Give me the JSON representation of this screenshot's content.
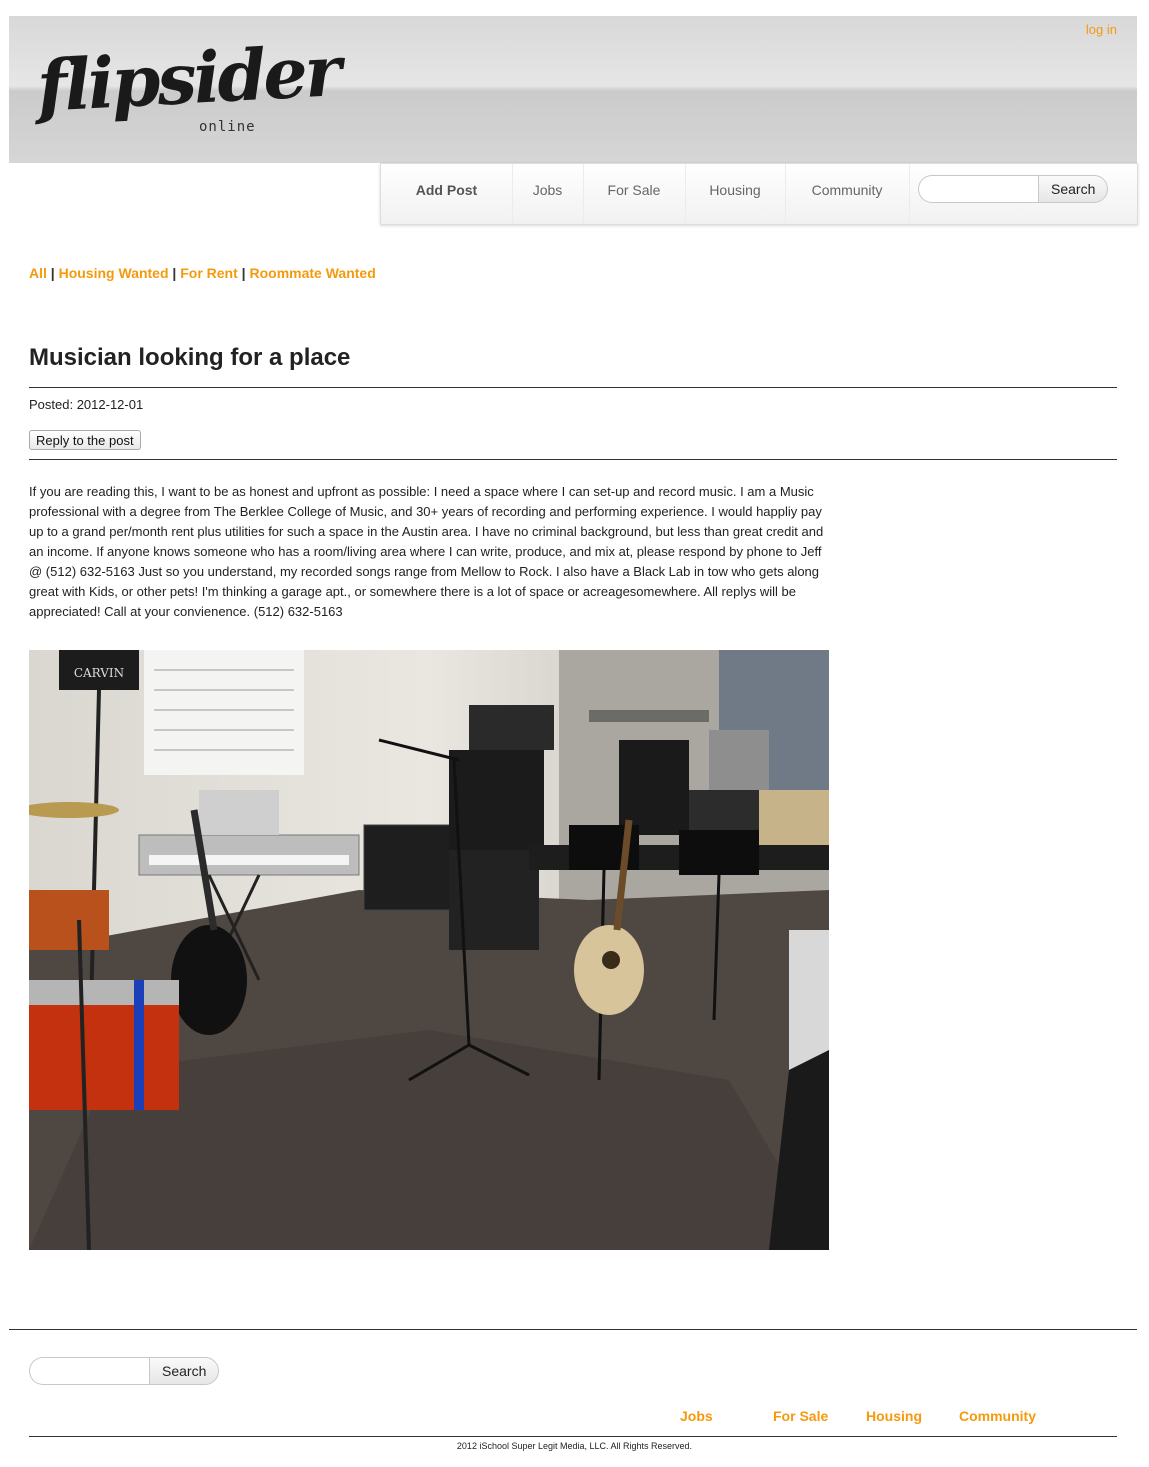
{
  "header": {
    "logo_text": "flipsider",
    "logo_sub": "online",
    "login_label": "log in"
  },
  "nav": {
    "items": [
      "Add Post",
      "Jobs",
      "For Sale",
      "Housing",
      "Community"
    ],
    "search_button": "Search",
    "search_placeholder": ""
  },
  "filters": {
    "all": "All",
    "housing_wanted": "Housing Wanted",
    "for_rent": "For Rent",
    "roommate_wanted": "Roommate Wanted",
    "separator": "|"
  },
  "post": {
    "title": "Musician looking for a place",
    "posted": "Posted: 2012-12-01",
    "reply_label": "Reply to the post",
    "body": "If you are reading this, I want to be as honest and upfront as possible: I need a space where I can set-up and record music. I am a Music professional with a degree from The Berklee College of Music, and 30+ years of recording and performing experience. I would happliy pay up to a grand per/month rent plus utilities for such a space in the Austin area. I have no criminal background, but less than great credit and an income. If anyone knows someone who has a room/living area where I can write, produce, and mix at, please respond by phone to Jeff @ (512) 632-5163 Just so you understand, my recorded songs range from Mellow to Rock. I also have a Black Lab in tow who gets along great with Kids, or other pets! I'm thinking a garage apt., or somewhere there is a lot of space or acreagesomewhere. All replys will be appreciated! Call at your convienence. (512) 632-5163",
    "photo_labels": {
      "amp_brand": "CARVIN"
    }
  },
  "footer": {
    "search_button": "Search",
    "links": [
      "Jobs",
      "For Sale",
      "Housing",
      "Community"
    ],
    "copyright": "2012 iSchool Super Legit Media, LLC. All Rights Reserved."
  },
  "colors": {
    "accent": "#f59a0c"
  }
}
